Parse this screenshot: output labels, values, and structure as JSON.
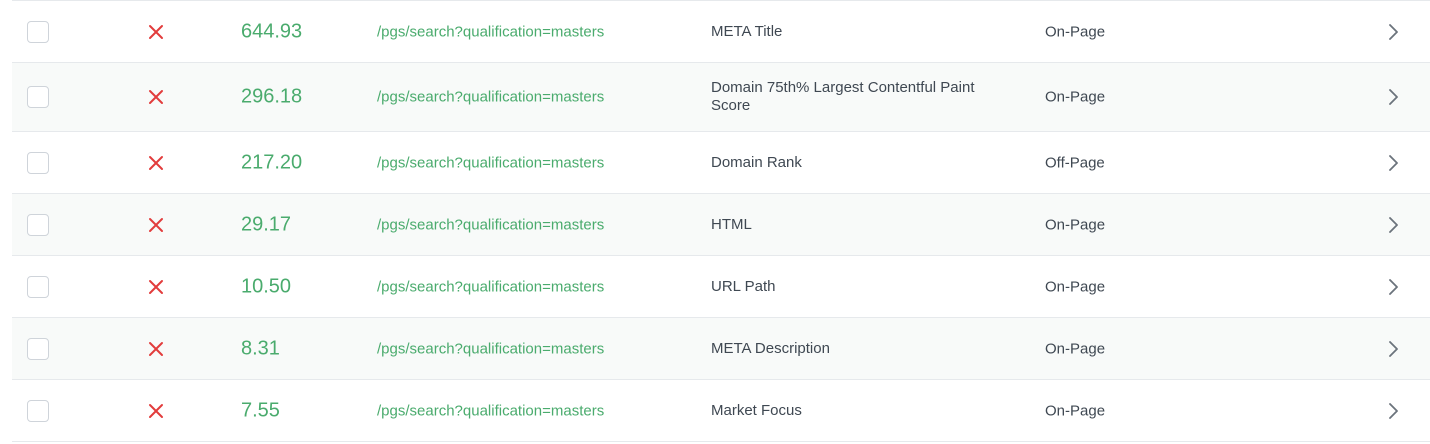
{
  "colors": {
    "score_green": "#4aab6d",
    "status_red": "#e23c3c",
    "text_dark": "#3f4852",
    "row_shade": "#f8faf9",
    "divider": "#e6e9ec"
  },
  "icons": {
    "status": "x-mark-icon",
    "row_action": "chevron-right-icon"
  },
  "rows": [
    {
      "score": "644.93",
      "url": "/pgs/search?qualification=masters",
      "factor": "META Title",
      "category": "On-Page"
    },
    {
      "score": "296.18",
      "url": "/pgs/search?qualification=masters",
      "factor": "Domain 75th% Largest Contentful Paint Score",
      "category": "On-Page"
    },
    {
      "score": "217.20",
      "url": "/pgs/search?qualification=masters",
      "factor": "Domain Rank",
      "category": "Off-Page"
    },
    {
      "score": "29.17",
      "url": "/pgs/search?qualification=masters",
      "factor": "HTML",
      "category": "On-Page"
    },
    {
      "score": "10.50",
      "url": "/pgs/search?qualification=masters",
      "factor": "URL Path",
      "category": "On-Page"
    },
    {
      "score": "8.31",
      "url": "/pgs/search?qualification=masters",
      "factor": "META Description",
      "category": "On-Page"
    },
    {
      "score": "7.55",
      "url": "/pgs/search?qualification=masters",
      "factor": "Market Focus",
      "category": "On-Page"
    }
  ]
}
